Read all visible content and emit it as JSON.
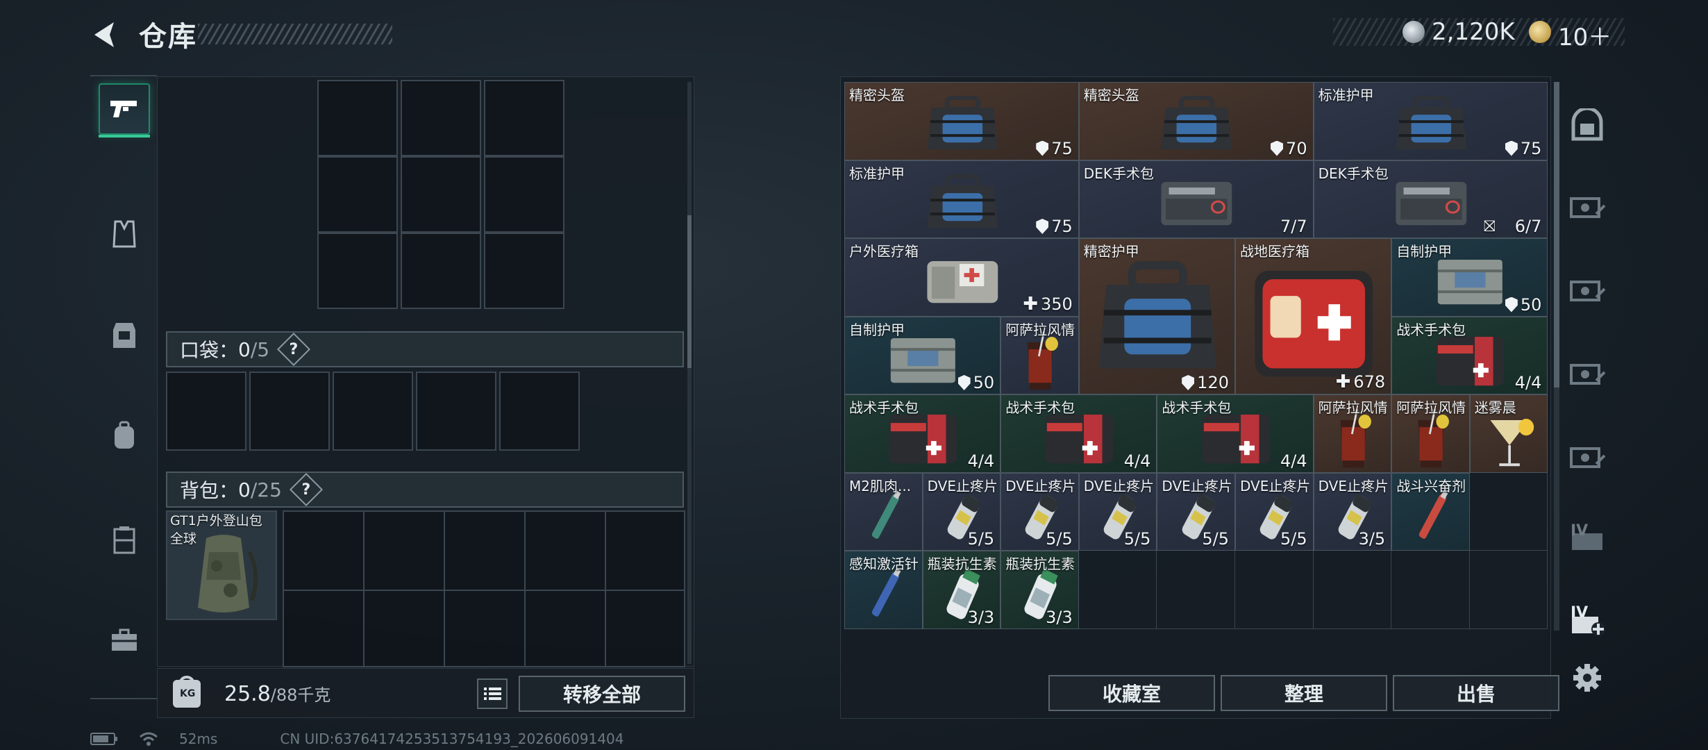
{
  "header": {
    "title": "仓库",
    "currency_silver": "2,120K",
    "currency_gold": "10＋"
  },
  "left_panel": {
    "pocket_label": "口袋：",
    "pocket_count": "0",
    "pocket_total": "/5",
    "backpack_label": "背包：",
    "backpack_count": "0",
    "backpack_total": "/25",
    "question": "?",
    "equipped_backpack_name": "GT1户外登山包",
    "equipped_backpack_sub": "全球",
    "weight_value": "25.8",
    "weight_max": "/88千克",
    "transfer_all": "转移全部"
  },
  "inventory": {
    "items": [
      {
        "name": "精密头盔",
        "value": "75",
        "badge": "shield"
      },
      {
        "name": "精密头盔",
        "value": "70",
        "badge": "shield"
      },
      {
        "name": "标准护甲",
        "value": "75",
        "badge": "shield"
      },
      {
        "name": "标准护甲",
        "value": "75",
        "badge": "shield"
      },
      {
        "name": "DEK手术包",
        "value": "7/7",
        "badge": ""
      },
      {
        "name": "DEK手术包",
        "value": "6/7",
        "badge": "lock"
      },
      {
        "name": "户外医疗箱",
        "value": "350",
        "badge": "plus"
      },
      {
        "name": "精密护甲",
        "value": "120",
        "badge": "shield"
      },
      {
        "name": "战地医疗箱",
        "value": "678",
        "badge": "plus"
      },
      {
        "name": "自制护甲",
        "value": "50",
        "badge": "shield"
      },
      {
        "name": "自制护甲",
        "value": "50",
        "badge": "shield"
      },
      {
        "name": "阿萨拉风情",
        "value": "",
        "badge": ""
      },
      {
        "name": "战术手术包",
        "value": "4/4",
        "badge": ""
      },
      {
        "name": "战术手术包",
        "value": "4/4",
        "badge": ""
      },
      {
        "name": "战术手术包",
        "value": "4/4",
        "badge": ""
      },
      {
        "name": "战术手术包",
        "value": "4/4",
        "badge": ""
      },
      {
        "name": "阿萨拉风情",
        "value": "",
        "badge": ""
      },
      {
        "name": "阿萨拉风情",
        "value": "",
        "badge": ""
      },
      {
        "name": "迷雾晨",
        "value": "",
        "badge": ""
      },
      {
        "name": "M2肌肉...",
        "value": "",
        "badge": ""
      },
      {
        "name": "DVE止疼片",
        "value": "5/5",
        "badge": ""
      },
      {
        "name": "DVE止疼片",
        "value": "5/5",
        "badge": ""
      },
      {
        "name": "DVE止疼片",
        "value": "5/5",
        "badge": ""
      },
      {
        "name": "DVE止疼片",
        "value": "5/5",
        "badge": ""
      },
      {
        "name": "DVE止疼片",
        "value": "5/5",
        "badge": ""
      },
      {
        "name": "DVE止疼片",
        "value": "3/5",
        "badge": ""
      },
      {
        "name": "战斗兴奋剂",
        "value": "",
        "badge": ""
      },
      {
        "name": "感知激活针",
        "value": "",
        "badge": ""
      },
      {
        "name": "瓶装抗生素",
        "value": "3/3",
        "badge": ""
      },
      {
        "name": "瓶装抗生素",
        "value": "3/3",
        "badge": ""
      }
    ],
    "buttons": {
      "collection": "收藏室",
      "sort": "整理",
      "sell": "出售"
    }
  },
  "side_icons": [
    "safe-icon",
    "vehicle-tier-1-icon",
    "vehicle-tier-2-icon",
    "vehicle-tier-3-icon",
    "vehicle-tier-4-icon",
    "vehicle-tier-5-icon",
    "vehicle-tier-add-icon",
    "settings-icon"
  ],
  "side_labels": {
    "tier_iv": "IV",
    "tier_iv_add": "IV"
  },
  "footer": {
    "ping": "52ms",
    "uid": "CN UID:637641742535137541​93_202606091404"
  }
}
